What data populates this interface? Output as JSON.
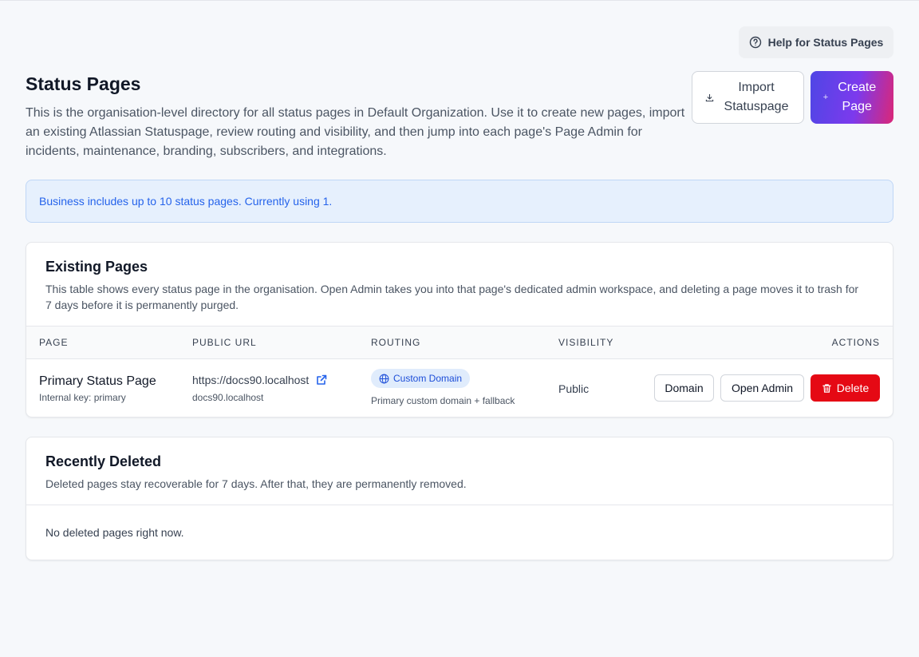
{
  "help": {
    "label": "Help for Status Pages",
    "icon": "question-circle-icon"
  },
  "header": {
    "title": "Status Pages",
    "description": "This is the organisation-level directory for all status pages in Default Organization. Use it to create new pages, import an existing Atlassian Statuspage, review routing and visibility, and then jump into each page's Page Admin for incidents, maintenance, branding, subscribers, and integrations.",
    "import_label": "Import Statuspage",
    "create_label": "Create Page"
  },
  "banner": {
    "text": "Business includes up to 10 status pages. Currently using 1."
  },
  "existing": {
    "title": "Existing Pages",
    "description": "This table shows every status page in the organisation. Open Admin takes you into that page's dedicated admin workspace, and deleting a page moves it to trash for 7 days before it is permanently purged.",
    "columns": {
      "page": "PAGE",
      "public_url": "PUBLIC URL",
      "routing": "ROUTING",
      "visibility": "VISIBILITY",
      "actions": "ACTIONS"
    },
    "rows": [
      {
        "name": "Primary Status Page",
        "key": "Internal key: primary",
        "url": "https://docs90.localhost",
        "host": "docs90.localhost",
        "routing_badge": "Custom Domain",
        "routing_note": "Primary custom domain + fallback",
        "visibility": "Public",
        "domain_label": "Domain",
        "admin_label": "Open Admin",
        "delete_label": "Delete"
      }
    ]
  },
  "deleted": {
    "title": "Recently Deleted",
    "description": "Deleted pages stay recoverable for 7 days. After that, they are permanently removed.",
    "empty": "No deleted pages right now."
  },
  "colors": {
    "accent_gradient": [
      "#4f46e5",
      "#7c3aed",
      "#db2777"
    ],
    "danger": "#e50914",
    "info_text": "#2563eb"
  }
}
